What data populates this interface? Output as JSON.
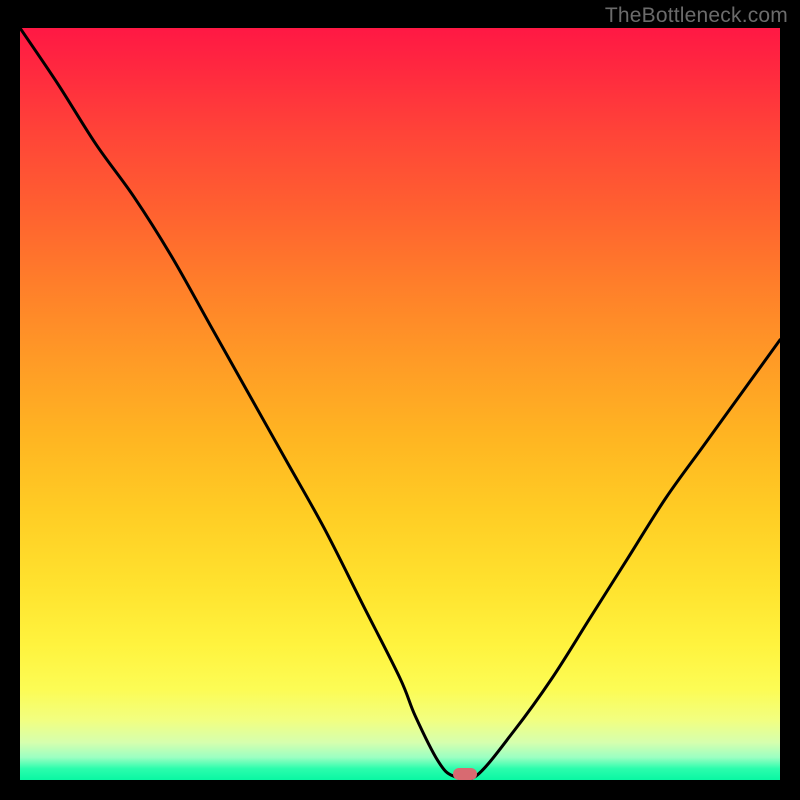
{
  "watermark": "TheBottleneck.com",
  "chart_data": {
    "type": "line",
    "title": "",
    "xlabel": "",
    "ylabel": "",
    "xlim": [
      0,
      100
    ],
    "ylim": [
      0,
      100
    ],
    "grid": false,
    "legend": false,
    "background": "rainbow-vertical-gradient",
    "series": [
      {
        "name": "bottleneck-curve",
        "color": "#000000",
        "x": [
          0,
          5,
          10,
          15,
          20,
          25,
          30,
          35,
          40,
          45,
          50,
          52,
          55,
          57,
          60,
          65,
          70,
          75,
          80,
          85,
          90,
          95,
          100
        ],
        "values": [
          100,
          92,
          84,
          77,
          69,
          60,
          51,
          42,
          33,
          23,
          13,
          8,
          2,
          0,
          0,
          6,
          13,
          21,
          29,
          37,
          44,
          51,
          58
        ]
      }
    ],
    "marker": {
      "x": 58.5,
      "y": 0,
      "color": "#d86a71",
      "shape": "pill"
    }
  }
}
